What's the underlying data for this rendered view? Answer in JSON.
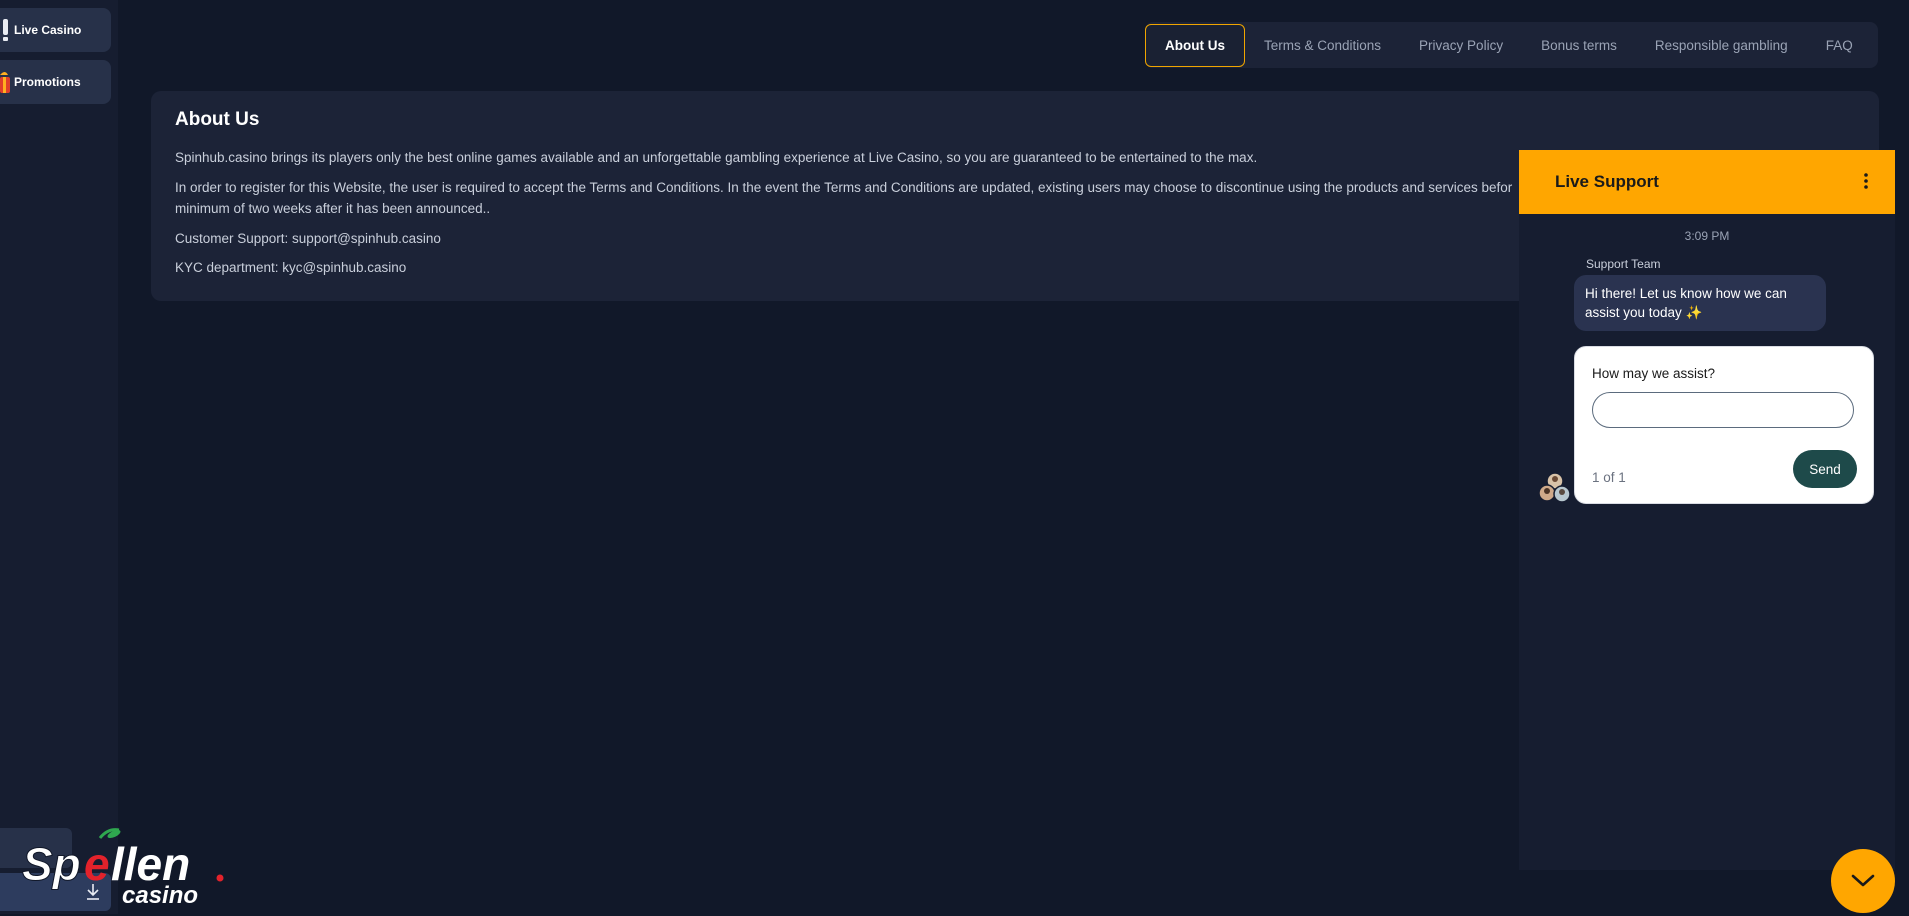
{
  "sidebar": {
    "items": [
      {
        "label": "Live Casino",
        "icon": "live-casino-icon"
      },
      {
        "label": "Promotions",
        "icon": "gift-icon"
      }
    ],
    "download_icon": "download-icon"
  },
  "logo": {
    "text_main": "Spellen",
    "text_sub": "casino"
  },
  "tabs": [
    {
      "label": "About Us",
      "active": true
    },
    {
      "label": "Terms & Conditions"
    },
    {
      "label": "Privacy Policy"
    },
    {
      "label": "Bonus terms"
    },
    {
      "label": "Responsible gambling"
    },
    {
      "label": "FAQ"
    }
  ],
  "content": {
    "title": "About Us",
    "paragraphs": [
      "Spinhub.casino brings its players only the best online games available and an unforgettable gambling experience at Live Casino, so you are guaranteed to be entertained to the max.",
      "In order to register for this Website, the user is required to accept the Terms and Conditions. In the event the Terms and Conditions are updated, existing users may choose to discontinue using the products and services befor",
      "minimum of two weeks after it has been announced..",
      "Customer Support: support@spinhub.casino",
      "KYC department: kyc@spinhub.casino"
    ]
  },
  "chat": {
    "title": "Live Support",
    "time": "3:09 PM",
    "sender": "Support Team",
    "message": "Hi there! Let us know how we can assist you today ✨",
    "form_label": "How may we assist?",
    "input_value": "",
    "counter": "1 of 1",
    "send_label": "Send"
  },
  "colors": {
    "accent": "#ffa600",
    "background": "#111829",
    "card": "#1c2337",
    "send_button": "#1e4a4a"
  }
}
